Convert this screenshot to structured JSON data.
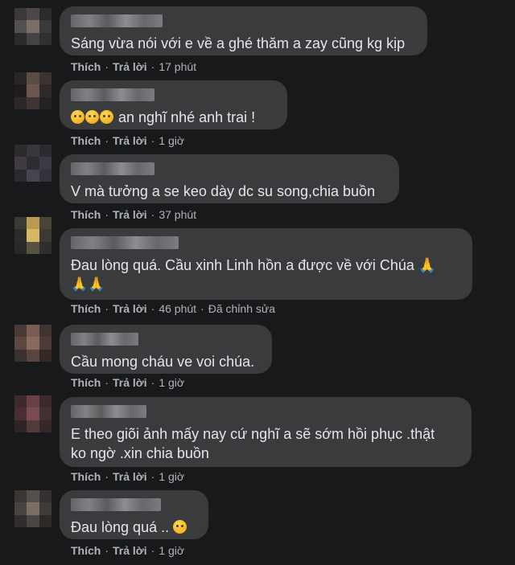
{
  "comments": [
    {
      "text": "Sáng vừa nói với e về a ghé thăm a zay cũng kg kịp",
      "like": "Thích",
      "reply": "Trả lời",
      "time": "17 phút",
      "edited": ""
    },
    {
      "text": "an nghĩ nhé anh trai !",
      "emoji_prefix": [
        "sad-face-emoji",
        "sad-face-emoji",
        "sad-face-emoji"
      ],
      "like": "Thích",
      "reply": "Trả lời",
      "time": "1 giờ",
      "edited": ""
    },
    {
      "text": "V mà tưởng a se keo dày dc su song,chia buồn",
      "like": "Thích",
      "reply": "Trả lời",
      "time": "37 phút",
      "edited": ""
    },
    {
      "text_line1": "Đau lòng quá. Cầu xinh Linh hồn a được về với Chúa 🙏",
      "text_line2": "🙏🙏",
      "like": "Thích",
      "reply": "Trả lời",
      "time": "46 phút",
      "edited": "Đã chỉnh sửa"
    },
    {
      "text": "Cầu mong cháu ve voi chúa.",
      "like": "Thích",
      "reply": "Trả lời",
      "time": "1 giờ",
      "edited": ""
    },
    {
      "text_line1": "E theo giõi ảnh mấy nay cứ nghĩ a sẽ sớm hồi phục .thật",
      "text_line2": "ko ngờ .xin chia buồn",
      "like": "Thích",
      "reply": "Trả lời",
      "time": "1 giờ",
      "edited": ""
    },
    {
      "text": "Đau lòng quá ..",
      "emoji_suffix": "sad-face-emoji",
      "like": "Thích",
      "reply": "Trả lời",
      "time": "1 giờ",
      "edited": ""
    }
  ],
  "colors": {
    "background": "#18191a",
    "bubble": "#3a3b3c",
    "text": "#e4e6eb",
    "secondary_text": "#b0b3b8"
  }
}
